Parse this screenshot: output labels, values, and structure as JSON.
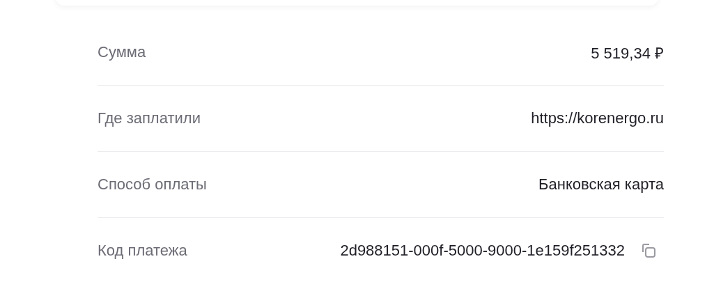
{
  "rows": [
    {
      "label": "Сумма",
      "value": "5 519,34 ₽",
      "copyable": false
    },
    {
      "label": "Где заплатили",
      "value": "https://korenergo.ru",
      "copyable": false
    },
    {
      "label": "Способ оплаты",
      "value": "Банковская карта",
      "copyable": false
    },
    {
      "label": "Код платежа",
      "value": "2d988151-000f-5000-9000-1e159f251332",
      "copyable": true
    }
  ]
}
